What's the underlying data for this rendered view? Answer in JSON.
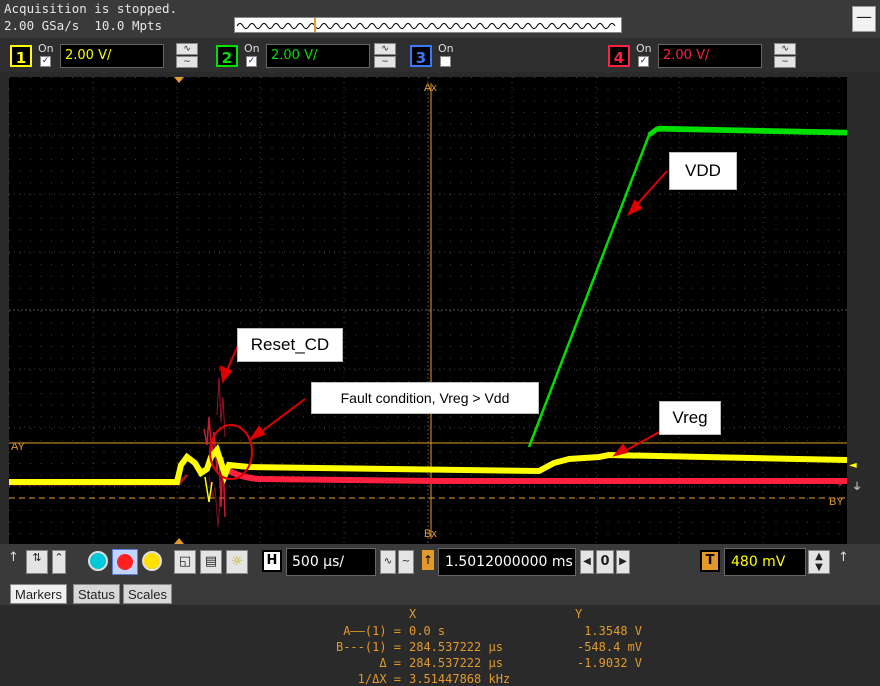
{
  "status": {
    "acquisition": "Acquisition is stopped.",
    "sample_rate": "2.00 GSa/s",
    "memory_depth": "10.0 Mpts"
  },
  "channels": [
    {
      "number": "1",
      "on_label": "On",
      "enabled": true,
      "scale": "2.00 V/",
      "color": "#ffff00"
    },
    {
      "number": "2",
      "on_label": "On",
      "enabled": true,
      "scale": "2.00 V/",
      "color": "#00e000"
    },
    {
      "number": "3",
      "on_label": "On",
      "enabled": false,
      "scale": "",
      "color": "#3a78ff"
    },
    {
      "number": "4",
      "on_label": "On",
      "enabled": true,
      "scale": "2.00 V/",
      "color": "#ff2040"
    }
  ],
  "waveform": {
    "annotations": {
      "vdd": "VDD",
      "reset": "Reset_CD",
      "fault": "Fault condition, Vreg > Vdd",
      "vreg": "Vreg"
    },
    "markers_on_screen": {
      "ax": "Ax",
      "bx": "Bx",
      "ay": "AY",
      "by": "BY",
      "ch4_label": "4",
      "trigger_label": "T"
    }
  },
  "controls": {
    "horizontal_label": "H",
    "timebase": "500 µs/",
    "delay": "1.5012000000 ms",
    "delay_nav_center": "0",
    "trigger_label": "T",
    "trigger_level": "480 mV"
  },
  "tabs": [
    "Markers",
    "Status",
    "Scales"
  ],
  "markers": {
    "header_x": "X",
    "header_y": "Y",
    "rows": [
      {
        "label": "A——(1) =",
        "x": "0.0 s",
        "y": "1.3548 V"
      },
      {
        "label": "B---(1) =",
        "x": "284.537222 µs",
        "y": "-548.4 mV"
      },
      {
        "label": "Δ =",
        "x": "284.537222 µs",
        "y": "-1.9032 V"
      },
      {
        "label": "1/ΔX =",
        "x": "3.51447868 kHz",
        "y": ""
      }
    ]
  },
  "colors": {
    "ch1": "#ffff00",
    "ch2": "#00e000",
    "ch4": "#ff2040",
    "marker": "#e39a2a",
    "callout_arrow": "#e00000"
  }
}
